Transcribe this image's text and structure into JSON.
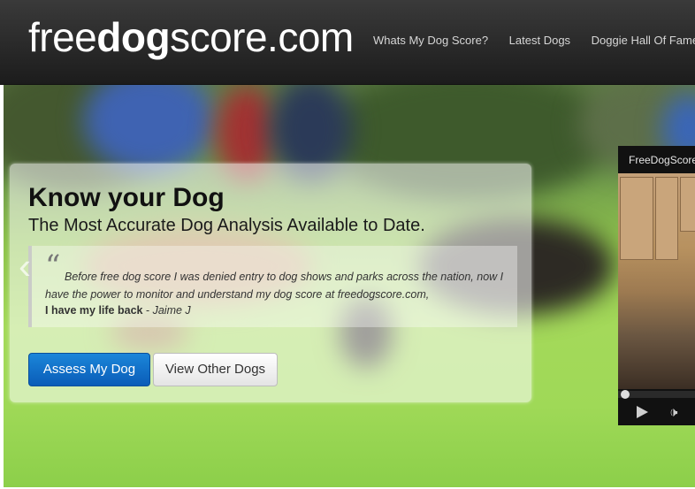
{
  "brand": {
    "light_left": "free",
    "bold": "dog",
    "light_right": "score.com"
  },
  "nav": [
    {
      "label": "Whats My Dog Score?"
    },
    {
      "label": "Latest Dogs"
    },
    {
      "label": "Doggie Hall Of Fame"
    }
  ],
  "hero": {
    "title": "Know your Dog",
    "subtitle": "The Most Accurate Dog Analysis Available to Date.",
    "quote": {
      "mark": "“",
      "text": "Before free dog score I was denied entry to dog shows and parks across the nation, now I have the power to monitor and understand my dog score at freedogscore.com,",
      "author_strong": "I have my life back",
      "author_sep": " - ",
      "author_name": "Jaime J"
    },
    "buttons": {
      "primary": "Assess My Dog",
      "secondary": "View Other Dogs"
    }
  },
  "video": {
    "title": "FreeDogScore"
  },
  "colors": {
    "primary": "#0a6fd0",
    "navbar": "#2b2b2b",
    "grass": "#9fd957"
  }
}
